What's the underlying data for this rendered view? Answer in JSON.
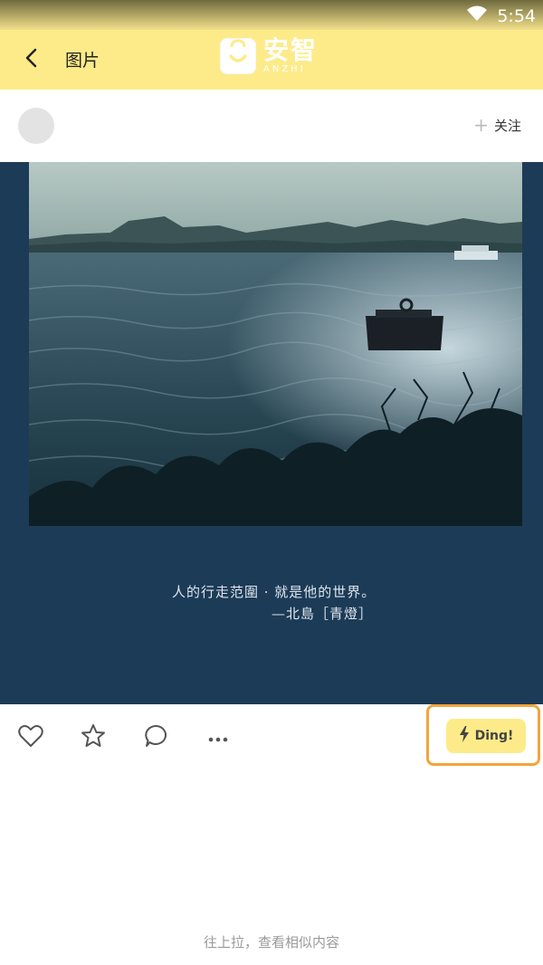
{
  "status_bar": {
    "time": "5:54"
  },
  "header": {
    "title": "图片",
    "logo_cn": "安智",
    "logo_en": "ANZHI"
  },
  "author": {
    "follow_label": "关注"
  },
  "post": {
    "caption_line1": "人的行走范圍 · 就是他的世界。",
    "caption_line2": "—北島［青燈］"
  },
  "actions": {
    "ding_label": "Ding!"
  },
  "footer": {
    "hint": "往上拉，查看相似内容"
  },
  "icons": [
    "back-icon",
    "wifi-icon",
    "heart-icon",
    "star-icon",
    "comment-icon",
    "more-icon",
    "lightning-icon"
  ],
  "colors": {
    "header_bg": "#fdeb8a",
    "post_bg": "#1c3b57",
    "ding_highlight": "#f3a53b"
  }
}
